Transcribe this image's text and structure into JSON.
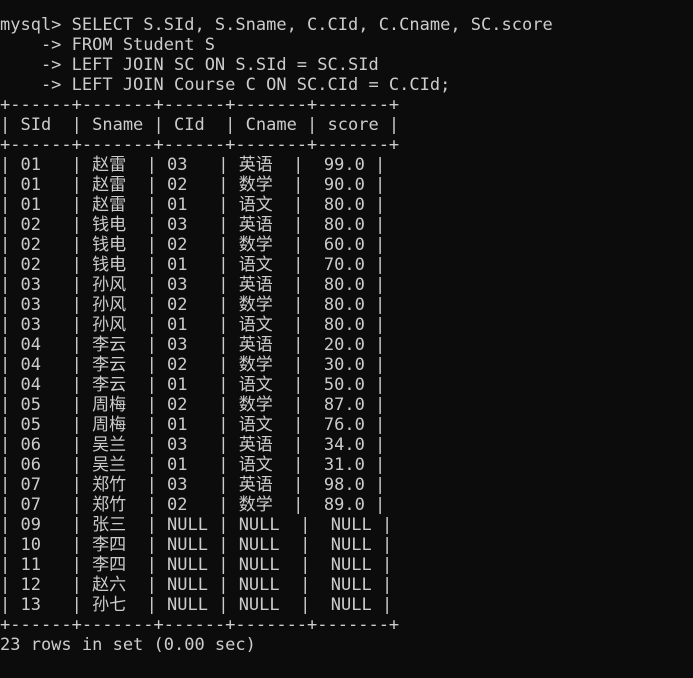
{
  "terminal": {
    "command_lines": [
      "mysql> SELECT S.SId, S.Sname, C.CId, C.Cname, SC.score",
      "    -> FROM Student S",
      "    -> LEFT JOIN SC ON S.SId = SC.SId",
      "    -> LEFT JOIN Course C ON SC.CId = C.CId;"
    ],
    "border_line": "+------+-------+------+-------+-------+",
    "header_line": "| SId  | Sname | CId  | Cname | score |",
    "row_lines": [
      "| 01   | 赵雷  | 03   | 英语  |  99.0 |",
      "| 01   | 赵雷  | 02   | 数学  |  90.0 |",
      "| 01   | 赵雷  | 01   | 语文  |  80.0 |",
      "| 02   | 钱电  | 03   | 英语  |  80.0 |",
      "| 02   | 钱电  | 02   | 数学  |  60.0 |",
      "| 02   | 钱电  | 01   | 语文  |  70.0 |",
      "| 03   | 孙风  | 03   | 英语  |  80.0 |",
      "| 03   | 孙风  | 02   | 数学  |  80.0 |",
      "| 03   | 孙风  | 01   | 语文  |  80.0 |",
      "| 04   | 李云  | 03   | 英语  |  20.0 |",
      "| 04   | 李云  | 02   | 数学  |  30.0 |",
      "| 04   | 李云  | 01   | 语文  |  50.0 |",
      "| 05   | 周梅  | 02   | 数学  |  87.0 |",
      "| 05   | 周梅  | 01   | 语文  |  76.0 |",
      "| 06   | 吴兰  | 03   | 英语  |  34.0 |",
      "| 06   | 吴兰  | 01   | 语文  |  31.0 |",
      "| 07   | 郑竹  | 03   | 英语  |  98.0 |",
      "| 07   | 郑竹  | 02   | 数学  |  89.0 |",
      "| 09   | 张三  | NULL | NULL  |  NULL |",
      "| 10   | 李四  | NULL | NULL  |  NULL |",
      "| 11   | 李四  | NULL | NULL  |  NULL |",
      "| 12   | 赵六  | NULL | NULL  |  NULL |",
      "| 13   | 孙七  | NULL | NULL  |  NULL |"
    ],
    "summary": "23 rows in set (0.00 sec)"
  }
}
